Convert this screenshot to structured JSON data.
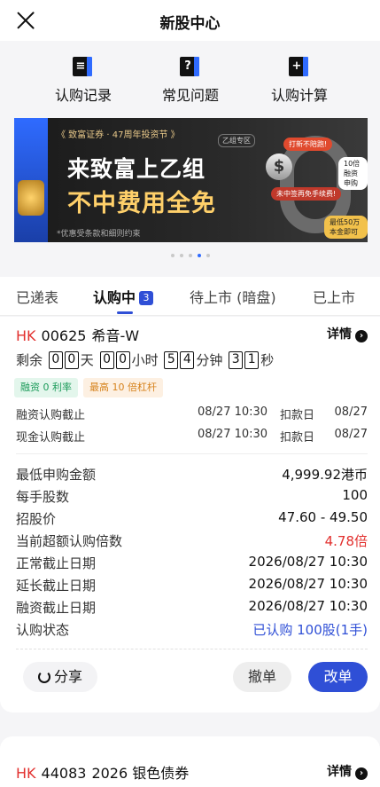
{
  "header": {
    "title": "新股中心"
  },
  "quick_links": [
    {
      "label": "认购记录",
      "icon": "book-icon",
      "glyph": "≡"
    },
    {
      "label": "常见问题",
      "icon": "question-icon",
      "glyph": "?"
    },
    {
      "label": "认购计算",
      "icon": "calculator-icon",
      "glyph": "+"
    }
  ],
  "banner": {
    "top_tag": "《 致富证券 · 47周年投资节 》",
    "line1": "来致富上乙组",
    "line2": "不中费用全免",
    "note": "*优惠受条款和细则约束",
    "zone": "乙组专区",
    "pill1": "打新不陪跑!",
    "pill2": "未中签再免手续费!",
    "pill3": "10倍融资申购",
    "pill4": "最低50万本金即可",
    "dollar": "$",
    "page_count": 5,
    "active_index": 3
  },
  "tabs": [
    {
      "label": "已递表"
    },
    {
      "label": "认购中",
      "badge": "3"
    },
    {
      "label": "待上市 (暗盘)"
    },
    {
      "label": "已上市"
    }
  ],
  "ipo1": {
    "market": "HK",
    "code": "00625",
    "name": "希音-W",
    "detail_label": "详情",
    "countdown": {
      "prefix": "剩余",
      "day_digits": [
        "0",
        "0"
      ],
      "day_unit": "天",
      "hour_digits": [
        "0",
        "0"
      ],
      "hour_unit": "小时",
      "min_digits": [
        "5",
        "4"
      ],
      "min_unit": "分钟",
      "sec_digits": [
        "3",
        "1"
      ],
      "sec_unit": "秒"
    },
    "chips": {
      "margin_rate": "融资 0 利率",
      "leverage": "最高 10 倍杠杆"
    },
    "deadlines": [
      {
        "label": "融资认购截止",
        "time": "08/27 10:30",
        "label2": "扣款日",
        "date2": "08/27"
      },
      {
        "label": "现金认购截止",
        "time": "08/27 10:30",
        "label2": "扣款日",
        "date2": "08/27"
      }
    ],
    "info": [
      {
        "label": "最低申购金额",
        "value": "4,999.92港币"
      },
      {
        "label": "每手股数",
        "value": "100"
      },
      {
        "label": "招股价",
        "value": "47.60 - 49.50"
      },
      {
        "label": "当前超额认购倍数",
        "value": "4.78倍"
      },
      {
        "label": "正常截止日期",
        "value": "2026/08/27 10:30"
      },
      {
        "label": "延长截止日期",
        "value": "2026/08/27 10:30"
      },
      {
        "label": "融资截止日期",
        "value": "2026/08/27 10:30"
      },
      {
        "label": "认购状态",
        "value": "已认购 100股(1手)"
      }
    ],
    "actions": {
      "share": "分享",
      "cancel": "撤单",
      "modify": "改单"
    }
  },
  "ipo2": {
    "market": "HK",
    "code": "44083",
    "name": "2026 银色债券",
    "detail_label": "详情"
  },
  "colors": {
    "accent": "#2f4fd6",
    "market_red": "#e2302e",
    "chip_green": "#1c9b5a",
    "chip_orange": "#d6821c"
  }
}
